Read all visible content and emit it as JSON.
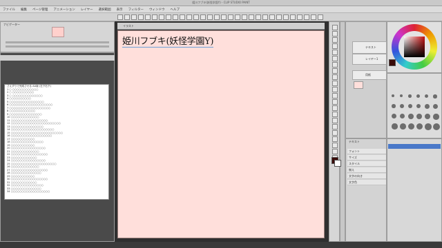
{
  "window": {
    "title": "姫川フブキ(妖怪学園Y) - CLIP STUDIO PAINT"
  },
  "menu": [
    "ファイル",
    "編集",
    "ページ管理",
    "アニメーション",
    "レイヤー",
    "選択範囲",
    "表示",
    "フィルター",
    "ウィンドウ",
    "ヘルプ"
  ],
  "navigator": {
    "label": "ナビゲーター"
  },
  "canvas": {
    "tab_label": "イラスト",
    "text": "姫川フブキ(妖怪学園Y)",
    "color": "#ffdfdb"
  },
  "document_lines": [
    "さえずりで完成させる AA版 (左下右下)",
    "1 ○ ○○○○○○○○○○○○",
    "2 ○ ○○○○○○○○○○",
    "3 ○ ○○○○○○○○○○○○○○",
    "4 ○○○○○○○○○○",
    "5 ○○○○○○○○○○○○○○○○",
    "6 ○○○○○○○○○○○○○○○○○○○○",
    "7 ○○○○○○○○○○○○○○○○○○○",
    "8 ○○○○○○○○○○○○",
    "9 ○○○○○○○○○○○○○○○",
    "10 ○○○○○○○○○○○○○",
    "11 ○○○○○○○○○○○○○○○○○",
    "12 ○○○○○○○○○○○○○○○○○○○○○○○",
    "13 ○○○○○○○○○○○○○○○",
    "14 ○○○○○○○○○○○○○○○○○○○○",
    "15 ○○○○○○○○○○○○○○○○○○○○○○○○",
    "16 ○○○○○○○○○○○○○○○○○○○",
    "17 ○○○○○○○○○○○",
    "18 ○○○○○○○○○○○○○○○",
    "19 ○○○○○○○○○○○",
    "20 ○○○○○○○○○○○○○○○○",
    "21 ○○○○○○○○○○○○○",
    "22 ○○○○○○○○○○○○○○○○○",
    "23 ○○○○○○○○○○○○",
    "24 ○○○○○○○○○○○○○○○○",
    "25 ○○○○○○○○○○○○○○○○○○○○○",
    "26 ○○○○○○○○○○○○○",
    "27 ○○○○○○○○○○○○○○○○○",
    "28 ○○○○○○○○○○○○○○",
    "29 ○○○○○○○○○○○",
    "30 ○○○○○○○○○○○○○○○○○",
    "31 ○○○○○○○○○○○○",
    "32 ○○○○○○○○○○○○○○○",
    "33 ○○○○○○○○○○○○○○",
    "34 ○○○○○○○○○○○○○○○○○○"
  ],
  "layers": [
    {
      "name": "テキスト"
    },
    {
      "name": "レイヤー1"
    },
    {
      "name": "用紙"
    }
  ],
  "colors": {
    "main": "#3a0a08",
    "sub": "#ffffff",
    "accent_layer": "#4a79c9"
  },
  "tool_property": {
    "title": "テキスト",
    "rows": [
      "フォント",
      "サイズ",
      "スタイル",
      "揃え",
      "文字の向き",
      "文字色"
    ]
  }
}
